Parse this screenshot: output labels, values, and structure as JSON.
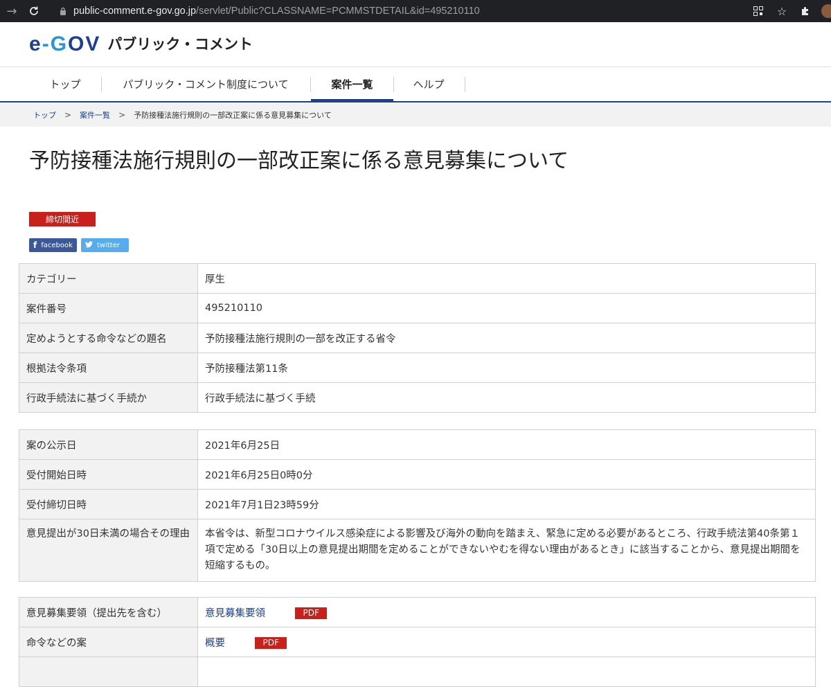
{
  "browser": {
    "url_host": "public-comment.e-gov.go.jp",
    "url_path": "/servlet/Public?CLASSNAME=PCMMSTDETAIL&id=495210110"
  },
  "header": {
    "logo": {
      "e": "e",
      "dash": "-",
      "g": "G",
      "ov": "OV"
    },
    "site_name": "パブリック・コメント"
  },
  "nav": {
    "items": [
      {
        "label": "トップ"
      },
      {
        "label": "パブリック・コメント制度について"
      },
      {
        "label": "案件一覧"
      },
      {
        "label": "ヘルプ"
      }
    ],
    "active": "案件一覧"
  },
  "breadcrumb": {
    "items": [
      "トップ",
      "案件一覧",
      "予防接種法施行規則の一部改正案に係る意見募集について"
    ],
    "separator": ">"
  },
  "page": {
    "title": "予防接種法施行規則の一部改正案に係る意見募集について",
    "status_badge": "締切間近",
    "share": {
      "facebook": "facebook",
      "twitter": "twitter"
    }
  },
  "tables": {
    "overview": [
      {
        "label": "カテゴリー",
        "value": "厚生"
      },
      {
        "label": "案件番号",
        "value": "495210110"
      },
      {
        "label": "定めようとする命令などの題名",
        "value": "予防接種法施行規則の一部を改正する省令"
      },
      {
        "label": "根拠法令条項",
        "value": "予防接種法第11条"
      },
      {
        "label": "行政手続法に基づく手続か",
        "value": "行政手続法に基づく手続"
      }
    ],
    "dates": [
      {
        "label": "案の公示日",
        "value": "2021年6月25日"
      },
      {
        "label": "受付開始日時",
        "value": "2021年6月25日0時0分"
      },
      {
        "label": "受付締切日時",
        "value": "2021年7月1日23時59分"
      },
      {
        "label": "意見提出が30日未満の場合その理由",
        "value": "本省令は、新型コロナウイルス感染症による影響及び海外の動向を踏まえ、緊急に定める必要があるところ、行政手続法第40条第１項で定める「30日以上の意見提出期間を定めることができないやむを得ない理由があるとき」に該当することから、意見提出期間を短縮するもの。"
      }
    ],
    "documents": [
      {
        "label": "意見募集要領（提出先を含む）",
        "link": "意見募集要領",
        "badge": "PDF"
      },
      {
        "label": "命令などの案",
        "link": "概要",
        "badge": "PDF"
      }
    ]
  },
  "colors": {
    "brand_navy": "#1b3f96",
    "brand_sky": "#2a95d4",
    "badge_red": "#c8211b",
    "facebook": "#3b5998",
    "twitter": "#55acee"
  }
}
